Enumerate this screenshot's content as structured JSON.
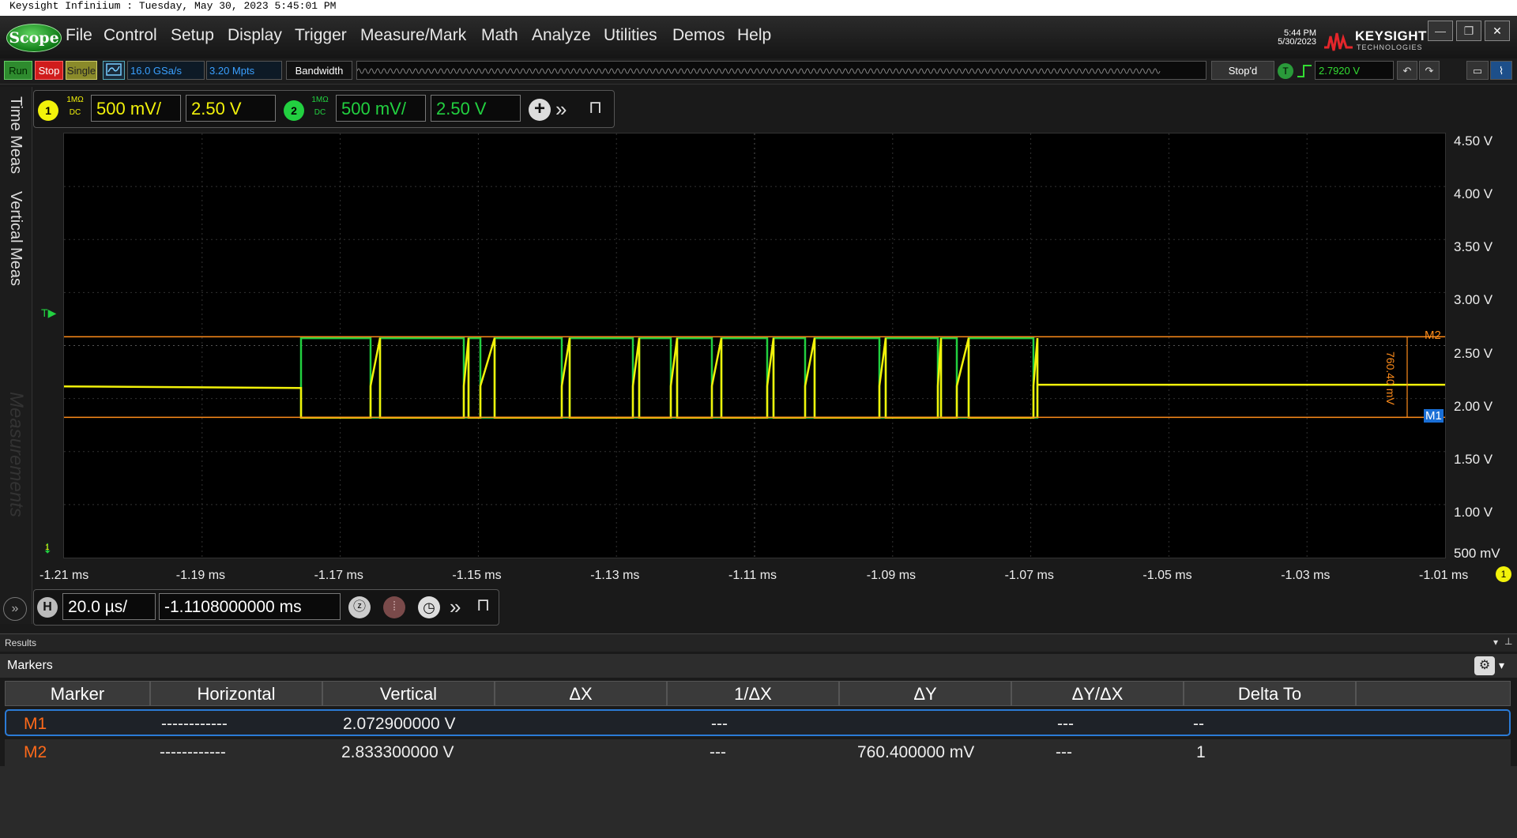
{
  "caption": "Keysight Infiniium : Tuesday, May 30, 2023 5:45:01 PM",
  "app": {
    "logo": "Scope",
    "menu": [
      "File",
      "Control",
      "Setup",
      "Display",
      "Trigger",
      "Measure/Mark",
      "Math",
      "Analyze",
      "Utilities",
      "Demos",
      "Help"
    ],
    "time": "5:44 PM",
    "date": "5/30/2023",
    "brand": "KEYSIGHT",
    "brand_sub": "TECHNOLOGIES"
  },
  "toolbar": {
    "run": "Run",
    "stop": "Stop",
    "single": "Single",
    "sample_rate": "16.0 GSa/s",
    "memory_depth": "3.20 Mpts",
    "bandwidth": "Bandwidth",
    "acq_status": "Stop'd",
    "trigger_level": "2.7920 V",
    "colors": {
      "run": "#2e8b2e",
      "stop": "#d01c1c",
      "single": "#8a8a2a"
    }
  },
  "channels": [
    {
      "number": "1",
      "impedance": "1MΩ",
      "coupling": "DC",
      "scale": "500 mV/",
      "offset": "2.50 V",
      "color": "#f2f20a"
    },
    {
      "number": "2",
      "impedance": "1MΩ",
      "coupling": "DC",
      "scale": "500 mV/",
      "offset": "2.50 V",
      "color": "#22d040"
    }
  ],
  "sidebar": {
    "tabs": [
      "Time Meas",
      "Vertical Meas"
    ],
    "watermark": "Measurements"
  },
  "waveform": {
    "volt_ticks": [
      "4.50 V",
      "4.00 V",
      "3.50 V",
      "3.00 V",
      "2.50 V",
      "2.00 V",
      "1.50 V",
      "1.00 V",
      "500 mV"
    ],
    "time_ticks": [
      "-1.21 ms",
      "-1.19 ms",
      "-1.17 ms",
      "-1.15 ms",
      "-1.13 ms",
      "-1.11 ms",
      "-1.09 ms",
      "-1.07 ms",
      "-1.05 ms",
      "-1.03 ms",
      "-1.01 ms"
    ],
    "marker_m1": "M1",
    "marker_m2": "M2",
    "marker_m1_volts": 2.0729,
    "marker_m2_volts": 2.8333,
    "delta_label": "760.40 mV",
    "trigger_marker": "T",
    "ground_marker": "1",
    "ch1_indicator": "1",
    "high_level_volts": 2.82,
    "low_level_volts": 2.07,
    "idle_level_volts": 2.38,
    "ch1_color": "#f2f20a",
    "ch2_color": "#22d040",
    "marker_color": "#ff8c1a"
  },
  "horizontal": {
    "label": "H",
    "scale": "20.0 µs/",
    "position": "-1.1108000000 ms"
  },
  "results": {
    "title": "Results",
    "panel": "Markers",
    "columns": [
      "Marker",
      "Horizontal",
      "Vertical",
      "ΔX",
      "1/ΔX",
      "ΔY",
      "ΔY/ΔX",
      "Delta To"
    ],
    "rows": [
      {
        "marker": "M1",
        "horizontal": "------------",
        "vertical": "2.072900000 V",
        "dx": "",
        "inv_dx": "---",
        "dy": "",
        "dy_dx": "---",
        "delta_to": "--"
      },
      {
        "marker": "M2",
        "horizontal": "------------",
        "vertical": "2.833300000 V",
        "dx": "",
        "inv_dx": "---",
        "dy": "760.400000 mV",
        "dy_dx": "---",
        "delta_to": "1"
      }
    ]
  }
}
